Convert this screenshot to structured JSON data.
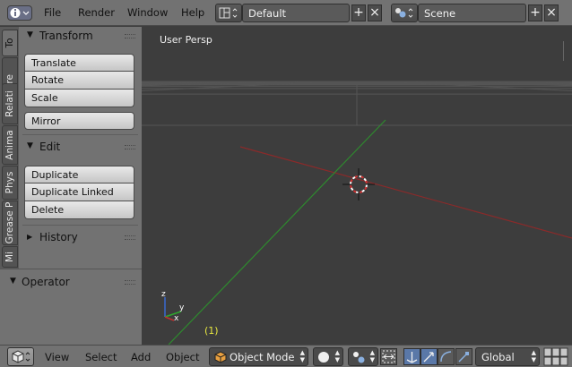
{
  "colors": {
    "accent": "#5a78a8",
    "panel": "#727272",
    "viewport_bg": "#3d3d3d",
    "x_axis": "#a83232",
    "y_axis": "#2e9a2e",
    "frame_label": "#e8e840"
  },
  "top_header": {
    "menu": [
      "File",
      "Render",
      "Window",
      "Help"
    ],
    "screen_layout": "Default",
    "scene": "Scene"
  },
  "tool_tabs": [
    "To",
    "Cre",
    "Relati",
    "Anima",
    "Phys",
    "Grease P",
    "Mi"
  ],
  "tool_shelf": {
    "transform": {
      "title": "Transform",
      "buttons": [
        "Translate",
        "Rotate",
        "Scale"
      ],
      "mirror": "Mirror"
    },
    "edit": {
      "title": "Edit",
      "buttons": [
        "Duplicate",
        "Duplicate Linked",
        "Delete"
      ]
    },
    "history": {
      "title": "History"
    }
  },
  "operator": {
    "title": "Operator"
  },
  "viewport": {
    "view_label": "User Persp",
    "frame_label": "(1)",
    "axes": {
      "x": "x",
      "y": "y",
      "z": "z"
    }
  },
  "bottom_header": {
    "menu": [
      "View",
      "Select",
      "Add",
      "Object"
    ],
    "mode": "Object Mode",
    "orientation": "Global"
  }
}
